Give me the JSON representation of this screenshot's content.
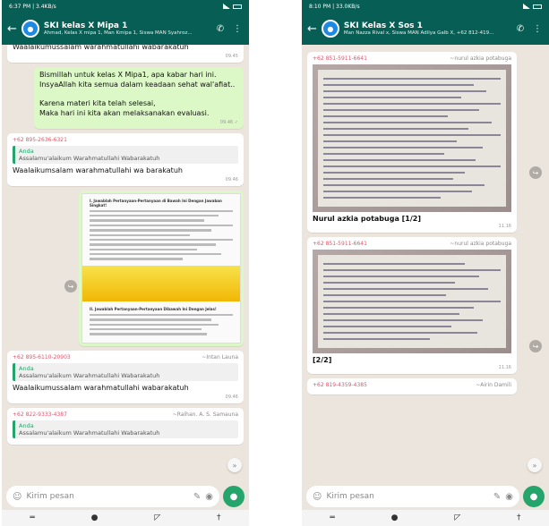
{
  "left": {
    "status_time": "6:37 PM | 3.4KB/s",
    "title": "SKI kelas X Mipa 1",
    "subtitle": "Ahmad, Kelas X mipa 1, Man Kmipa 1, Siswa MAN Syahroz...",
    "messages": [
      {
        "text": "Waalaikumussalam warahmatullahi wabarakatuh",
        "time": "09.45"
      },
      {
        "text": "Bismillah untuk kelas X Mipa1, apa kabar hari ini. InsyaAllah kita semua dalam keadaan sehat wal'afiat..\n\nKarena materi kita telah selesai,\nMaka hari ini kita akan melaksanakan evaluasi.",
        "time": "09.46 ✓"
      },
      {
        "sender": "+62 895-2636-6321",
        "quote_name": "Anda",
        "quote_text": "Assalamu'alaikum Warahmatullahi Wabarakatuh",
        "text": "Waalaikumsalam warahmatullahi wa barakatuh",
        "time": "09.46"
      },
      {
        "sender": "+62 895-6110-20903",
        "alias": "~Intan Launa",
        "quote_name": "Anda",
        "quote_text": "Assalamu'alaikum Warahmatullahi Wabarakatuh",
        "text": "Waalaikumussalam warahmatullahi wabarakatuh",
        "time": "09.46"
      },
      {
        "sender": "+62 822-9333-4387",
        "alias": "~Raihan. A. S. Samauna",
        "quote_name": "Anda",
        "quote_text": "Assalamu'alaikum Warahmatullahi Wabarakatuh"
      }
    ],
    "doc_heading_1": "I. Jawablah Pertanyaan-Pertanyaan di Bawah Ini Dengan Jawaban Singkat!",
    "doc_heading_2": "II. Jawablah Pertanyaan-Pertanyaan Dibawah Ini Dengan Jelas!",
    "input_placeholder": "Kirim pesan"
  },
  "right": {
    "status_time": "8:10 PM | 33.0KB/s",
    "title": "SKI Kelas X Sos 1",
    "subtitle": "Man Nazza Rival x, Siswa MAN Adilya Galb X, +62 812-419...",
    "messages": [
      {
        "sender": "+62 851-5911-6641",
        "alias": "~nurul azkia potabuga",
        "caption": "Nurul azkia potabuga [1/2]",
        "time": "11.16"
      },
      {
        "sender": "+62 851-5911-6641",
        "alias": "~nurul azkia potabuga",
        "caption": "[2/2]",
        "time": "11.16"
      },
      {
        "sender": "+62 819-4359-4385",
        "alias": "~Airin Damili"
      }
    ],
    "input_placeholder": "Kirim pesan"
  },
  "colors": {
    "header": "#075e54",
    "accent": "#25a46b",
    "outgoing": "#dcf8c6"
  }
}
